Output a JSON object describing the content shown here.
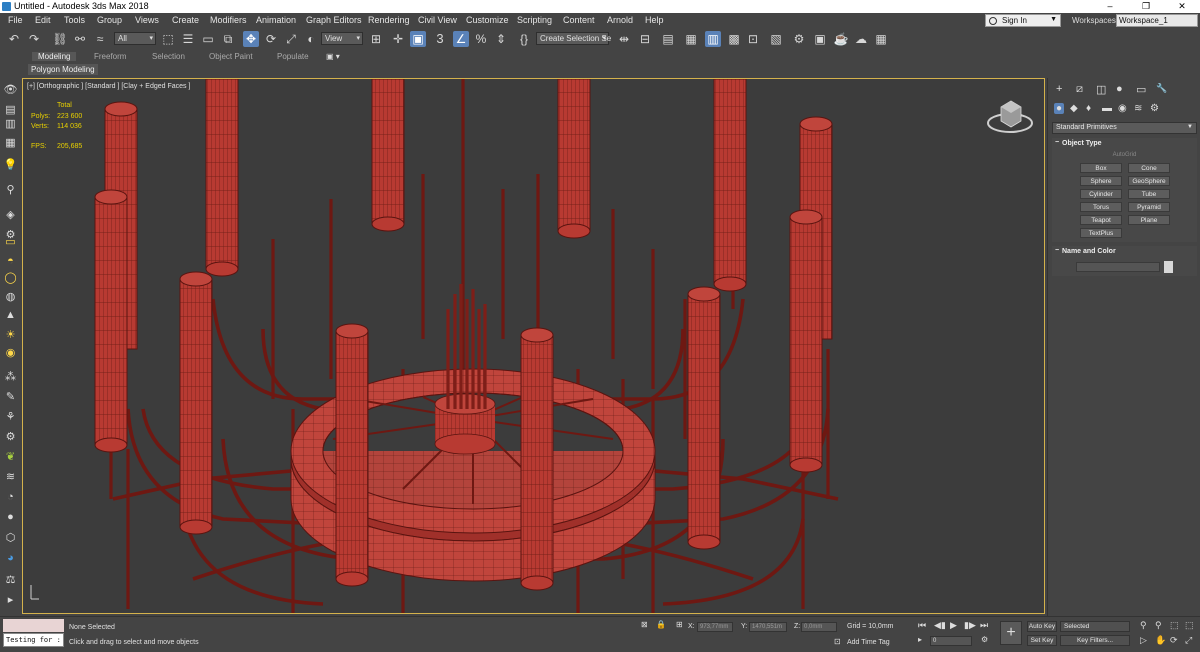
{
  "window": {
    "title": "Untitled - Autodesk 3ds Max 2018",
    "minimize": "–",
    "restore": "❐",
    "close": "✕"
  },
  "menu": [
    "File",
    "Edit",
    "Tools",
    "Group",
    "Views",
    "Create",
    "Modifiers",
    "Animation",
    "Graph Editors",
    "Rendering",
    "Civil View",
    "Customize",
    "Scripting",
    "Content",
    "Arnold",
    "Help"
  ],
  "account": {
    "signin": "Sign In",
    "workspaces_label": "Workspaces:",
    "workspace": "Workspace_1"
  },
  "toolbar": {
    "selection_filter": "All",
    "ref_coord": "View",
    "named_selection": "Create Selection Se",
    "snap_angle": "3",
    "percent_snap": "%",
    "icons": [
      "undo-icon",
      "redo-icon",
      "link-icon",
      "unlink-icon",
      "bind-spacewarp-icon",
      "select-object-icon",
      "select-by-name-icon",
      "rect-region-icon",
      "window-crossing-icon",
      "select-move-icon",
      "select-rotate-icon",
      "select-scale-icon",
      "select-place-icon",
      "select-manipulate-icon",
      "keyboard-shortcut-icon",
      "snaps-toggle-icon",
      "angle-snap-icon",
      "percent-snap-icon",
      "spinner-snap-icon",
      "edit-named-sel-icon",
      "mirror-icon",
      "align-icon",
      "scene-explorer-icon",
      "layer-explorer-icon",
      "ribbon-toggle-icon",
      "curve-editor-icon",
      "schematic-view-icon",
      "material-editor-icon",
      "render-setup-icon",
      "rendered-frame-icon",
      "render-icon",
      "render-cloud-icon",
      "a360-icon"
    ]
  },
  "ribbon": {
    "tabs": [
      "Modeling",
      "Freeform",
      "Selection",
      "Object Paint",
      "Populate"
    ],
    "active_tab": "Modeling",
    "sub_label": "Polygon Modeling",
    "extra": "▣ ▾"
  },
  "viewport": {
    "label": "[+] [Orthographic ] [Standard ] [Clay + Edged Faces ]",
    "stats": {
      "total_label": "Total",
      "polys_label": "Polys:",
      "polys": "223 600",
      "verts_label": "Verts:",
      "verts": "114 036",
      "fps_label": "FPS:",
      "fps": "205,685"
    },
    "colors": {
      "mesh": "#b83a32",
      "wire": "#5a1410",
      "bg": "#3c3c3c",
      "border": "#d4b24c"
    }
  },
  "command_panel": {
    "tabs": [
      "+",
      "⧄",
      "◫",
      "●",
      "▭",
      "🔧"
    ],
    "sub_tabs": [
      "●",
      "◆",
      "♦",
      "▬",
      "◉",
      "≋",
      "⚙"
    ],
    "category": "Standard Primitives",
    "object_type": {
      "title": "Object Type",
      "autogrid": "AutoGrid",
      "buttons": [
        "Box",
        "Cone",
        "Sphere",
        "GeoSphere",
        "Cylinder",
        "Tube",
        "Torus",
        "Pyramid",
        "Teapot",
        "Plane",
        "TextPlus"
      ]
    },
    "name_color": {
      "title": "Name and Color"
    }
  },
  "status": {
    "maxscript": "Testing for :",
    "selected": "None Selected",
    "prompt": "Click and drag to select and move objects",
    "x_label": "X:",
    "x": "973,77mm",
    "y_label": "Y:",
    "y": "1470,551m",
    "z_label": "Z:",
    "z": "0,0mm",
    "grid": "Grid = 10,0mm",
    "add_time_tag": "Add Time Tag",
    "frame": "0",
    "auto_key": "Auto Key",
    "set_key": "Set Key",
    "key_mode": "Selected",
    "key_filters": "Key Filters..."
  }
}
